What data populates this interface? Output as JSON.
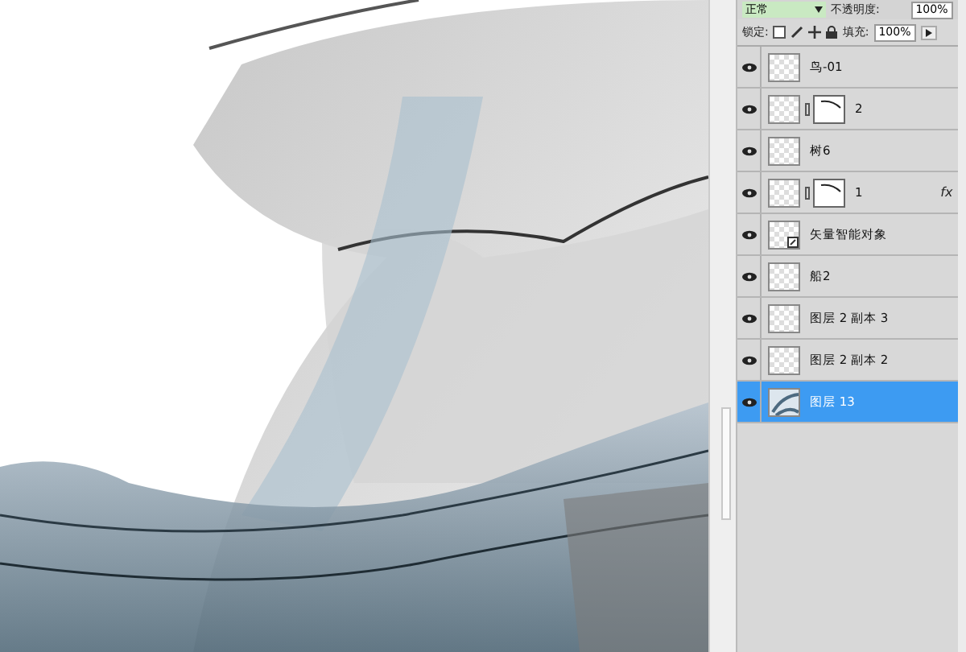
{
  "layers_panel": {
    "blend_mode": "正常",
    "opacity_label": "不透明度:",
    "opacity_value": "100%",
    "lock_label": "锁定:",
    "fill_label": "填充:",
    "fill_value": "100%",
    "layers": [
      {
        "name": "鸟-01",
        "kind": "plain",
        "visible": true,
        "selected": false
      },
      {
        "name": "2",
        "kind": "masked",
        "visible": true,
        "selected": false
      },
      {
        "name": "树6",
        "kind": "plain",
        "visible": true,
        "selected": false
      },
      {
        "name": "1",
        "kind": "masked",
        "visible": true,
        "effects_label": "fx",
        "selected": false
      },
      {
        "name": "矢量智能对象",
        "kind": "smart",
        "visible": true,
        "selected": false
      },
      {
        "name": "船2",
        "kind": "plain",
        "visible": true,
        "selected": false
      },
      {
        "name": "图层 2 副本 3",
        "kind": "plain",
        "visible": true,
        "selected": false
      },
      {
        "name": "图层 2 副本 2",
        "kind": "plain",
        "visible": true,
        "selected": false
      },
      {
        "name": "图层 13",
        "kind": "image",
        "visible": true,
        "selected": true
      }
    ]
  }
}
